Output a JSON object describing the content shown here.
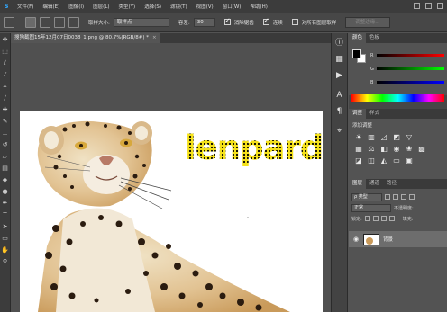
{
  "app": {
    "logo": "s"
  },
  "menu": [
    "文件(F)",
    "编辑(E)",
    "图像(I)",
    "图层(L)",
    "类型(Y)",
    "选择(S)",
    "滤镜(T)",
    "视图(V)",
    "窗口(W)",
    "帮助(H)"
  ],
  "options": {
    "sample_size_label": "取样大小:",
    "sample_size_value": "取样点",
    "tolerance_label": "容差:",
    "tolerance_value": "30",
    "antialias_label": "消除锯齿",
    "antialias_checked": true,
    "contiguous_label": "连续",
    "contiguous_checked": true,
    "all_layers_label": "对所有图层取样",
    "all_layers_checked": false,
    "refine_edge_label": "调整边缘..."
  },
  "document": {
    "tab_title": "搜狗截图15年12月07日0038_1.png @ 80.7%(RGB/8#) *",
    "text_layer_content": "lenpard"
  },
  "color_panel": {
    "tabs": [
      "颜色",
      "色板"
    ],
    "channels": [
      {
        "name": "R",
        "color": "#d82020"
      },
      {
        "name": "G",
        "color": "#20c020"
      },
      {
        "name": "B",
        "color": "#2040e0"
      }
    ]
  },
  "adjustments_panel": {
    "tabs": [
      "调整",
      "样式"
    ],
    "title": "添加调整",
    "icons": [
      "brightness-icon",
      "levels-icon",
      "curves-icon",
      "exposure-icon",
      "vibrance-icon",
      "hue-saturation-icon",
      "color-balance-icon",
      "black-white-icon",
      "photo-filter-icon",
      "channel-mixer-icon",
      "color-lookup-icon",
      "invert-icon",
      "posterize-icon",
      "threshold-icon",
      "gradient-map-icon",
      "selective-color-icon"
    ]
  },
  "layers_panel": {
    "tabs": [
      "图层",
      "通道",
      "路径"
    ],
    "filter_kind": "ρ 类型",
    "blend_mode": "正常",
    "opacity_label": "不透明度:",
    "lock_label": "锁定:",
    "fill_label": "填充:",
    "layers": [
      {
        "name": "背景",
        "visible": true
      }
    ]
  }
}
